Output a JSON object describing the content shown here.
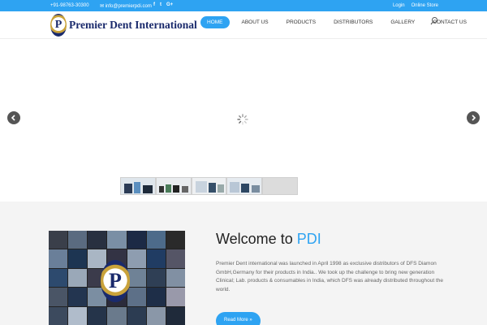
{
  "topbar": {
    "phone": "+91-98763-30300",
    "email": "info@premierpdi.com",
    "social": [
      {
        "icon": "facebook-icon",
        "glyph": "f"
      },
      {
        "icon": "twitter-icon",
        "glyph": "t"
      },
      {
        "icon": "google-plus-icon",
        "glyph": "G+"
      }
    ],
    "login": "Login",
    "online_store": "Online Store"
  },
  "header": {
    "logo_letter": "P",
    "logo_text": "Premier Dent International",
    "nav": [
      "HOME",
      "ABOUT US",
      "PRODUCTS",
      "DISTRIBUTORS",
      "GALLERY",
      "CONTACT US"
    ],
    "active_nav": "HOME"
  },
  "slider": {
    "thumbnail_count": 5
  },
  "welcome": {
    "title_prefix": "Welcome to ",
    "title_accent": "PDI",
    "body": "Premier Dent international was launched in April 1998 as exclusive distributors of DFS Diamon GmbH,Germany for their products in India.. We took up the challenge to bring new generation Clinical; Lab. products & consumables in India, which DFS was already distributed throughout the world.",
    "read_more": "Read More »",
    "collage_letter": "P"
  },
  "colors": {
    "accent": "#2ea3f2",
    "brand_navy": "#1a2a6c",
    "brand_gold": "#c9a23a"
  }
}
